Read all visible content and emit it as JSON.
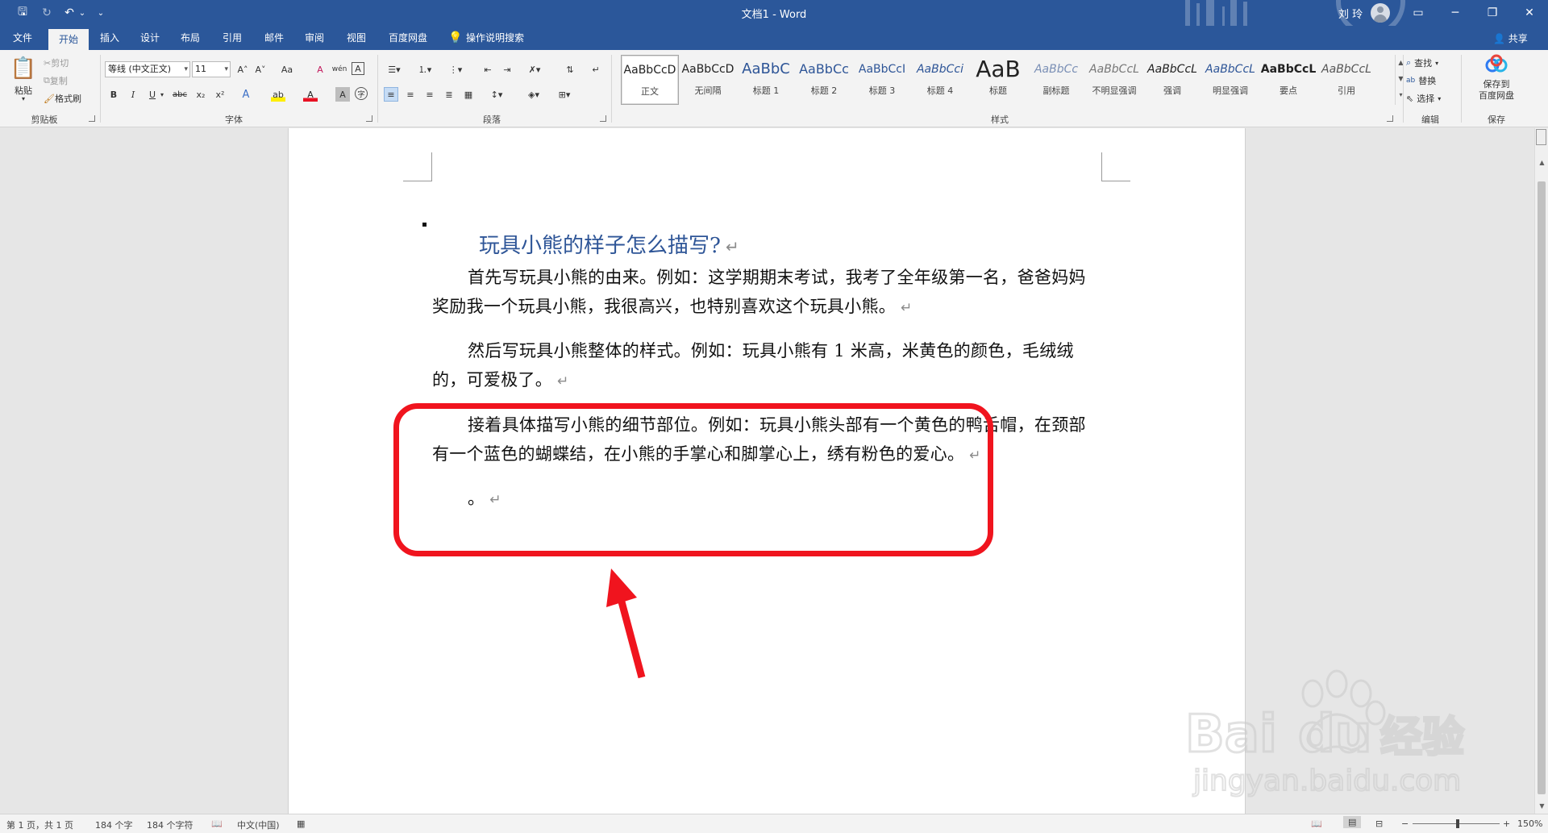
{
  "title_bar": {
    "doc_title": "文档1 - Word",
    "user_name": "刘 玲",
    "qat": {
      "save": "🖫",
      "redo": "↻",
      "undo": "↶",
      "undo_more": "⌄",
      "customize": "⌄"
    },
    "win": {
      "ribbon_opts": "▭",
      "minimize": "─",
      "restore": "❐",
      "close": "✕"
    }
  },
  "tabs": [
    "文件",
    "开始",
    "插入",
    "设计",
    "布局",
    "引用",
    "邮件",
    "审阅",
    "视图",
    "百度网盘"
  ],
  "tell_me": "操作说明搜索",
  "share_label": "共享",
  "clipboard": {
    "paste": "粘贴",
    "cut": "剪切",
    "copy": "复制",
    "format_painter": "格式刷",
    "label": "剪贴板"
  },
  "font": {
    "name": "等线 (中文正文)",
    "size": "11",
    "grow": "A˄",
    "shrink": "A˅",
    "case": "Aa",
    "clear": "A",
    "phonetic": "wén",
    "border": "A",
    "bold": "B",
    "italic": "I",
    "underline": "U",
    "strike": "abc",
    "sub": "x₂",
    "sup": "x²",
    "effects": "A",
    "highlight": "ab",
    "color": "A",
    "shade": "A",
    "enclose": "字",
    "label": "字体"
  },
  "paragraph": {
    "label": "段落"
  },
  "styles": {
    "label": "样式",
    "items": [
      {
        "sample": "AaBbCcD",
        "name": "正文",
        "color": "#222222"
      },
      {
        "sample": "AaBbCcD",
        "name": "无间隔",
        "color": "#222222"
      },
      {
        "sample": "AaBbC",
        "name": "标题 1",
        "color": "#2e5597"
      },
      {
        "sample": "AaBbCc",
        "name": "标题 2",
        "color": "#2e5597"
      },
      {
        "sample": "AaBbCcI",
        "name": "标题 3",
        "color": "#2e5597"
      },
      {
        "sample": "AaBbCci",
        "name": "标题 4",
        "color": "#2e5597"
      },
      {
        "sample": "AaB",
        "name": "标题",
        "color": "#222222"
      },
      {
        "sample": "AaBbCc",
        "name": "副标题",
        "color": "#7a8fb5"
      },
      {
        "sample": "AaBbCcL",
        "name": "不明显强调",
        "color": "#777777"
      },
      {
        "sample": "AaBbCcL",
        "name": "强调",
        "color": "#333333"
      },
      {
        "sample": "AaBbCcL",
        "name": "明显强调",
        "color": "#2e5597"
      },
      {
        "sample": "AaBbCcL",
        "name": "要点",
        "color": "#111111"
      },
      {
        "sample": "AaBbCcL",
        "name": "引用",
        "color": "#555555"
      }
    ]
  },
  "editing": {
    "find": "查找",
    "replace": "替换",
    "select": "选择",
    "label": "编辑"
  },
  "save_group": {
    "button_line1": "保存到",
    "button_line2": "百度网盘",
    "label": "保存"
  },
  "document": {
    "heading": "玩具小熊的样子怎么描写?",
    "para_mark": "↵",
    "paragraphs": [
      "首先写玩具小熊的由来。例如：这学期期末考试，我考了全年级第一名，爸爸妈妈奖励我一个玩具小熊，我很高兴，也特别喜欢这个玩具小熊。",
      "然后写玩具小熊整体的样式。例如：玩具小熊有 1 米高，米黄色的颜色，毛绒绒的，可爱极了。",
      "接着具体描写小熊的细节部位。例如：玩具小熊头部有一个黄色的鸭舌帽，在颈部有一个蓝色的蝴蝶结，在小熊的手掌心和脚掌心上，绣有粉色的爱心。",
      "。"
    ]
  },
  "annotation": {
    "color": "#f0141e"
  },
  "watermark": {
    "brand": "Bai",
    "du": "du",
    "cn": "经验",
    "url": "jingyan.baidu.com"
  },
  "status": {
    "page": "第 1 页，共 1 页",
    "words": "184 个字",
    "chars": "184 个字符",
    "lang": "中文(中国)",
    "zoom": "150%"
  },
  "colors": {
    "brand": "#2b579a",
    "ribbon": "#f3f3f3",
    "heading": "#2e5597"
  }
}
